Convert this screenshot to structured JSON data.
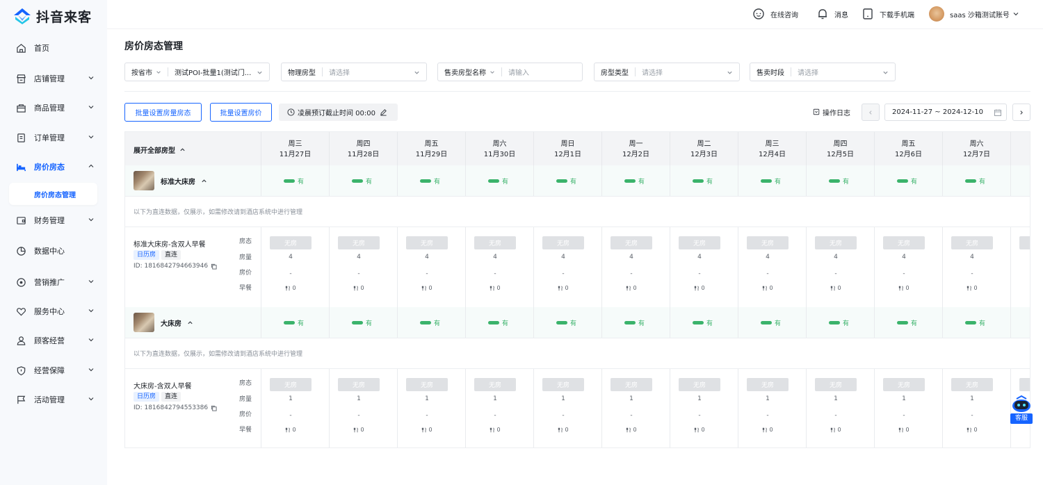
{
  "brand": {
    "name": "抖音来客"
  },
  "sidebar": {
    "items": [
      {
        "label": "首页",
        "icon": "home-icon",
        "has_children": false
      },
      {
        "label": "店铺管理",
        "icon": "store-icon",
        "has_children": true
      },
      {
        "label": "商品管理",
        "icon": "goods-icon",
        "has_children": true
      },
      {
        "label": "订单管理",
        "icon": "order-icon",
        "has_children": true
      },
      {
        "label": "房价房态",
        "icon": "bed-icon",
        "has_children": true,
        "active": true
      },
      {
        "label": "财务管理",
        "icon": "wallet-icon",
        "has_children": true
      },
      {
        "label": "数据中心",
        "icon": "pie-chart-icon",
        "has_children": false
      },
      {
        "label": "营销推广",
        "icon": "location-icon",
        "has_children": true
      },
      {
        "label": "服务中心",
        "icon": "heart-icon",
        "has_children": true
      },
      {
        "label": "顾客经营",
        "icon": "user-icon",
        "has_children": true
      },
      {
        "label": "经营保障",
        "icon": "shield-icon",
        "has_children": true
      },
      {
        "label": "活动管理",
        "icon": "flag-icon",
        "has_children": true
      }
    ],
    "sub_active": "房价房态管理"
  },
  "header": {
    "consult": "在线咨询",
    "messages": "消息",
    "download": "下载手机端",
    "account": "saas 沙箱测试账号"
  },
  "page": {
    "title": "房价房态管理"
  },
  "filters": {
    "region_label": "按省市",
    "region_value": "测试POI-批量1(测试门...",
    "physical_room_label": "物理房型",
    "physical_room_placeholder": "请选择",
    "sale_room_label": "售卖房型名称",
    "sale_room_placeholder": "请输入",
    "room_type_label": "房型类型",
    "room_type_placeholder": "请选择",
    "sale_period_label": "售卖时段",
    "sale_period_placeholder": "请选择"
  },
  "toolbar": {
    "batch_status": "批量设置房量房态",
    "batch_price": "批量设置房价",
    "cutoff": "凌晨预订截止时间 00:00",
    "oplog": "操作日志",
    "date_range": "2024-11-27 ~ 2024-12-10"
  },
  "grid": {
    "expand_all": "展开全部房型",
    "columns": [
      {
        "weekday": "周三",
        "date": "11月27日"
      },
      {
        "weekday": "周四",
        "date": "11月28日"
      },
      {
        "weekday": "周五",
        "date": "11月29日"
      },
      {
        "weekday": "周六",
        "date": "11月30日"
      },
      {
        "weekday": "周日",
        "date": "12月1日"
      },
      {
        "weekday": "周一",
        "date": "12月2日"
      },
      {
        "weekday": "周二",
        "date": "12月3日"
      },
      {
        "weekday": "周三",
        "date": "12月4日"
      },
      {
        "weekday": "周四",
        "date": "12月5日"
      },
      {
        "weekday": "周五",
        "date": "12月6日"
      },
      {
        "weekday": "周六",
        "date": "12月7日"
      }
    ],
    "row_labels": {
      "status": "房态",
      "quantity": "房量",
      "price": "房价",
      "breakfast": "早餐"
    },
    "available_text": "有",
    "status_text": "无房",
    "price_text": "-",
    "breakfast_text": "0",
    "notice": "以下为直连数据，仅展示，如需修改请到酒店系统中进行管理",
    "rooms": [
      {
        "name": "标准大床房",
        "plan": {
          "name": "标准大床房-含双人早餐",
          "tags": [
            "日历房",
            "直连"
          ],
          "id": "ID: 1816842794663946",
          "quantity": "4"
        }
      },
      {
        "name": "大床房",
        "plan": {
          "name": "大床房-含双人早餐",
          "tags": [
            "日历房",
            "直连"
          ],
          "id": "ID: 1816842794553386",
          "quantity": "1"
        }
      }
    ]
  },
  "service": {
    "label": "客服"
  },
  "colors": {
    "accent": "#1664ff",
    "available": "#3bb36b",
    "room_row_bg": "#f6fbfa",
    "status_box": "#dfe1e4"
  }
}
